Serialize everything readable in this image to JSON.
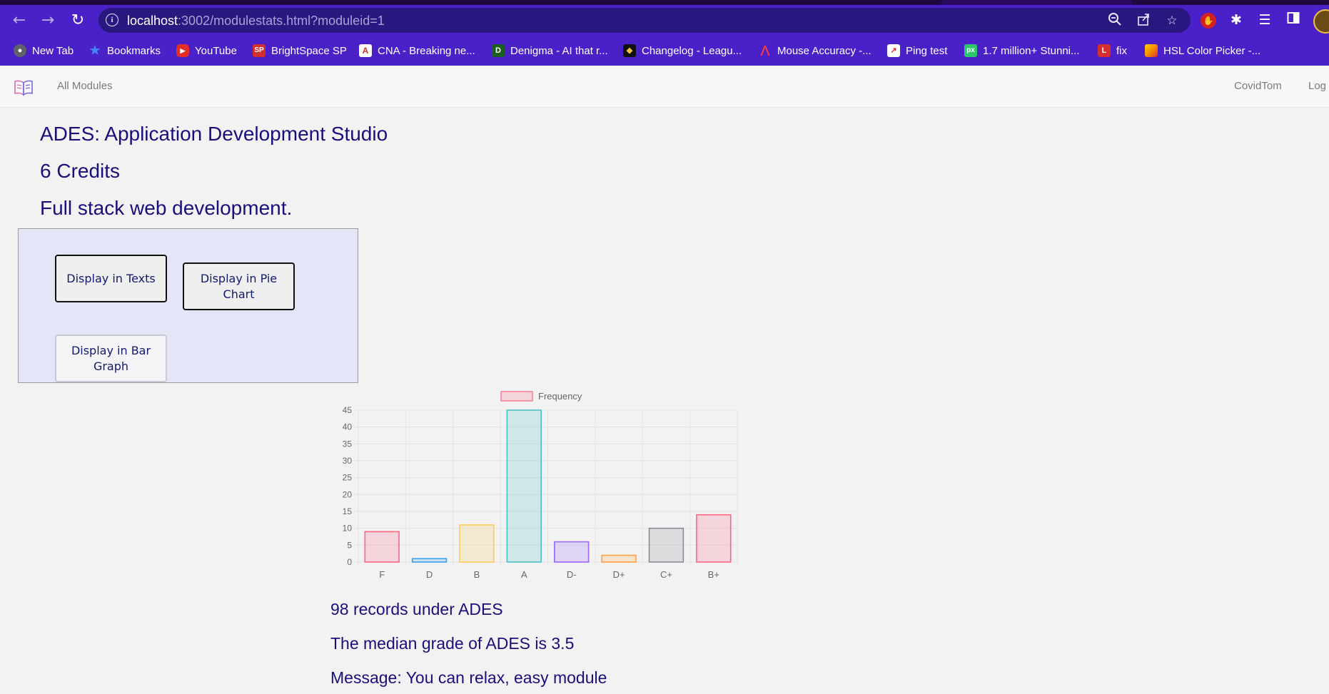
{
  "browser": {
    "url_host": "localhost",
    "url_rest": ":3002/modulestats.html?moduleid=1",
    "bookmarks": [
      {
        "label": "New Tab",
        "icon": "globe-icon",
        "color": "#5f6368"
      },
      {
        "label": "Bookmarks",
        "icon": "star-icon",
        "color": "#4285f4"
      },
      {
        "label": "YouTube",
        "icon": "youtube-icon",
        "color": "#e52d27"
      },
      {
        "label": "BrightSpace SP",
        "icon": "sp-icon",
        "color": "#d32f2f"
      },
      {
        "label": "CNA - Breaking ne...",
        "icon": "cna-icon",
        "color": "#ffffff"
      },
      {
        "label": "Denigma - AI that r...",
        "icon": "denigma-icon",
        "color": "#1b5e20"
      },
      {
        "label": "Changelog - Leagu...",
        "icon": "changelog-icon",
        "color": "#111111"
      },
      {
        "label": "Mouse Accuracy -...",
        "icon": "mouse-accuracy-icon",
        "color": "#e53935"
      },
      {
        "label": "Ping test",
        "icon": "ping-icon",
        "color": "#ffffff"
      },
      {
        "label": "1.7 million+ Stunni...",
        "icon": "pixabay-icon",
        "color": "#2ec66d"
      },
      {
        "label": "fix",
        "icon": "l-icon",
        "color": "#d32f2f"
      },
      {
        "label": "HSL Color Picker -...",
        "icon": "hsl-icon",
        "color": "#f57c00"
      }
    ]
  },
  "nav": {
    "all_modules": "All Modules",
    "user": "CovidTom",
    "logout": "Log"
  },
  "module": {
    "title": "ADES: Application Development Studio",
    "credits": "6 Credits",
    "description": "Full stack web development."
  },
  "buttons": {
    "texts": "Display in Texts",
    "pie": "Display in Pie Chart",
    "bar": "Display in Bar Graph"
  },
  "chart_data": {
    "type": "bar",
    "categories": [
      "F",
      "D",
      "B",
      "A",
      "D-",
      "D+",
      "C+",
      "B+"
    ],
    "series": [
      {
        "name": "Frequency",
        "values": [
          9,
          1,
          11,
          45,
          6,
          2,
          10,
          14
        ]
      }
    ],
    "colors": [
      "#ff6384",
      "#36a2eb",
      "#ffcd56",
      "#4bc0c0",
      "#9966ff",
      "#ff9f40",
      "#8a8a94",
      "#ff6384"
    ],
    "ylim": [
      0,
      45
    ],
    "yticks": [
      0,
      5,
      10,
      15,
      20,
      25,
      30,
      35,
      40,
      45
    ],
    "legend": "top",
    "grid": true
  },
  "stats": {
    "records": "98 records under ADES",
    "median": "The median grade of ADES is 3.5",
    "message": "Message: You can relax, easy module"
  }
}
